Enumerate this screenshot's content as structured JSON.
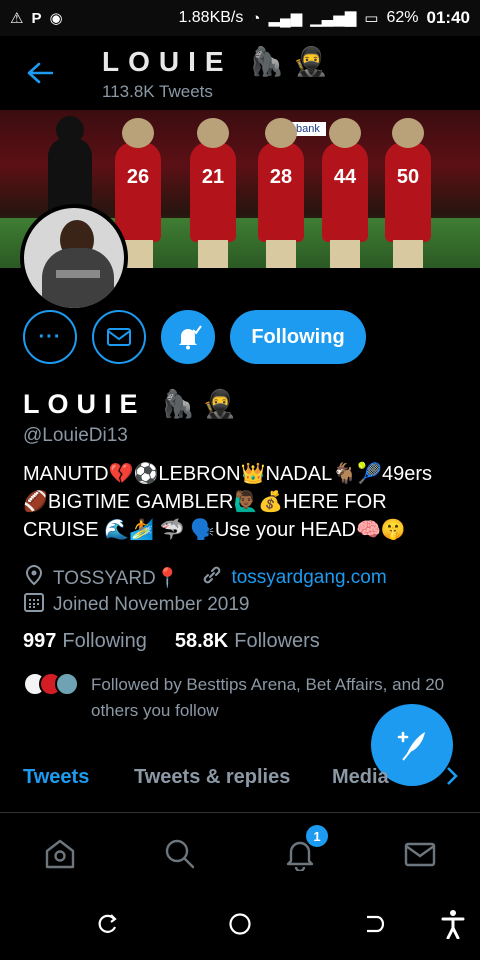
{
  "status_bar": {
    "left_icons": [
      "warning-icon",
      "p-icon",
      "browser-icon"
    ],
    "speed": "1.88KB/s",
    "battery": "62%",
    "time": "01:40"
  },
  "header": {
    "title": "LOUIE 🦍🥷",
    "subtitle": "113.8K Tweets"
  },
  "banner": {
    "sign": "bank",
    "jersey_numbers": [
      "26",
      "21",
      "28",
      "44",
      "50"
    ]
  },
  "actions": {
    "more_icon": "···",
    "follow_label": "Following"
  },
  "profile": {
    "name": "LOUIE 🦍🥷",
    "handle": "@LouieDi13",
    "bio": "MANUTD💔⚽LEBRON👑NADAL🐐🎾49ers\n🏈BIGTIME GAMBLER🙋🏾‍♂️💰HERE FOR\nCRUISE 🌊🏄 🦈 🗣️Use your HEAD🧠🤫",
    "location": "TOSSYARD📍",
    "website": "tossyardgang.com",
    "joined": "Joined November 2019",
    "following_count": "997",
    "following_label": "Following",
    "followers_count": "58.8K",
    "followers_label": "Followers",
    "followed_by": "Followed by Besttips Arena, Bet Affairs, and 20 others you follow"
  },
  "tabs": [
    {
      "label": "Tweets"
    },
    {
      "label": "Tweets & replies"
    },
    {
      "label": "Media"
    }
  ],
  "bottom_nav": {
    "notification_count": "1"
  },
  "colors": {
    "accent": "#1d9bf0",
    "muted": "#8b98a5",
    "background": "#000000"
  }
}
